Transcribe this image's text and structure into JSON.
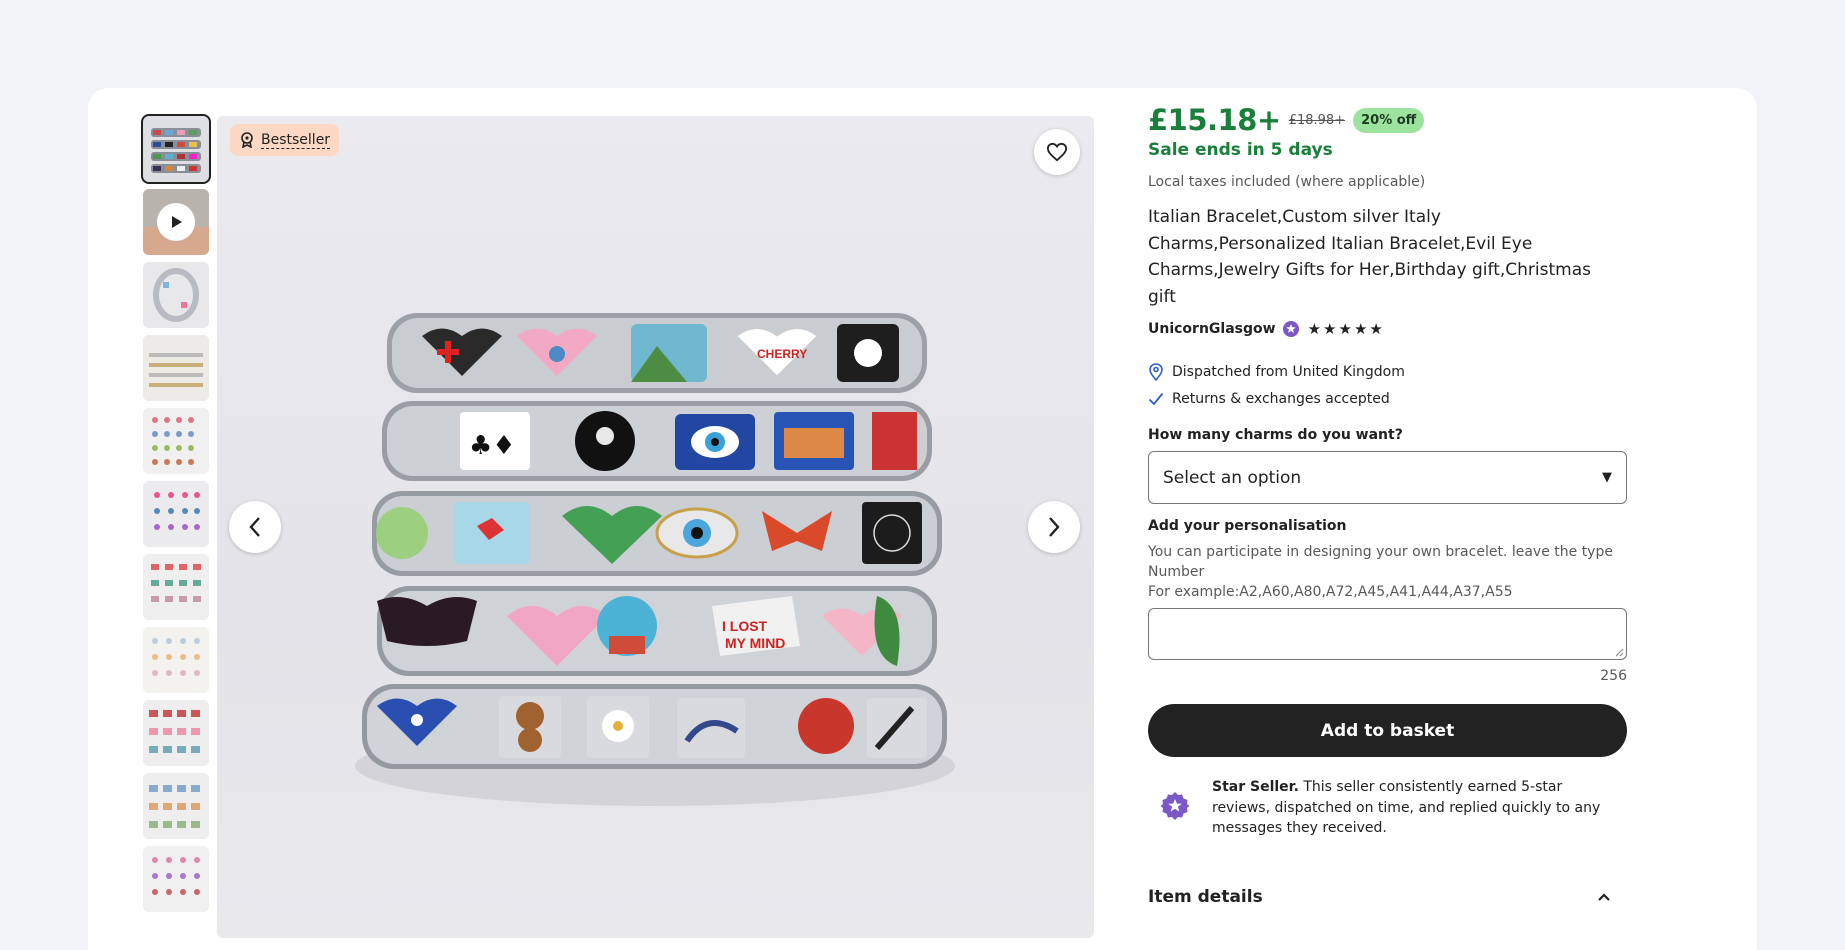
{
  "listing": {
    "badge_label": "Bestseller",
    "price": "£15.18+",
    "original_price": "£18.98+",
    "discount": "20% off",
    "sale_ends": "Sale ends in 5 days",
    "taxes_note": "Local taxes included (where applicable)",
    "title": "Italian Bracelet,Custom silver Italy Charms,Personalized Italian Bracelet,Evil Eye Charms,Jewelry Gifts for Her,Birthday gift,Christmas gift",
    "seller_name": "UnicornGlasgow",
    "rating_stars": 5,
    "dispatched_from": "Dispatched from United Kingdom",
    "returns": "Returns & exchanges accepted"
  },
  "options": {
    "question_label": "How many charms do you want?",
    "select_value": "Select an option"
  },
  "personalisation": {
    "label": "Add your personalisation",
    "instructions_line1": "You can participate in designing your own bracelet. leave the type Number",
    "instructions_line2": "For example:A2,A60,A80,A72,A45,A41,A44,A37,A55",
    "value": "",
    "char_counter": "256"
  },
  "actions": {
    "add_to_basket": "Add to basket"
  },
  "star_seller": {
    "title": "Star Seller.",
    "description": " This seller consistently earned 5-star reviews, dispatched on time, and replied quickly to any messages they received."
  },
  "sections": {
    "item_details": "Item details"
  },
  "gallery": {
    "thumbnail_count": 11,
    "selected_index": 0
  },
  "colors": {
    "price_green": "#1a7f3b",
    "discount_bg": "#9de3a0",
    "badge_bg": "#fdd8c4",
    "star_seller_purple": "#7b57c8",
    "button_dark": "#222222"
  }
}
